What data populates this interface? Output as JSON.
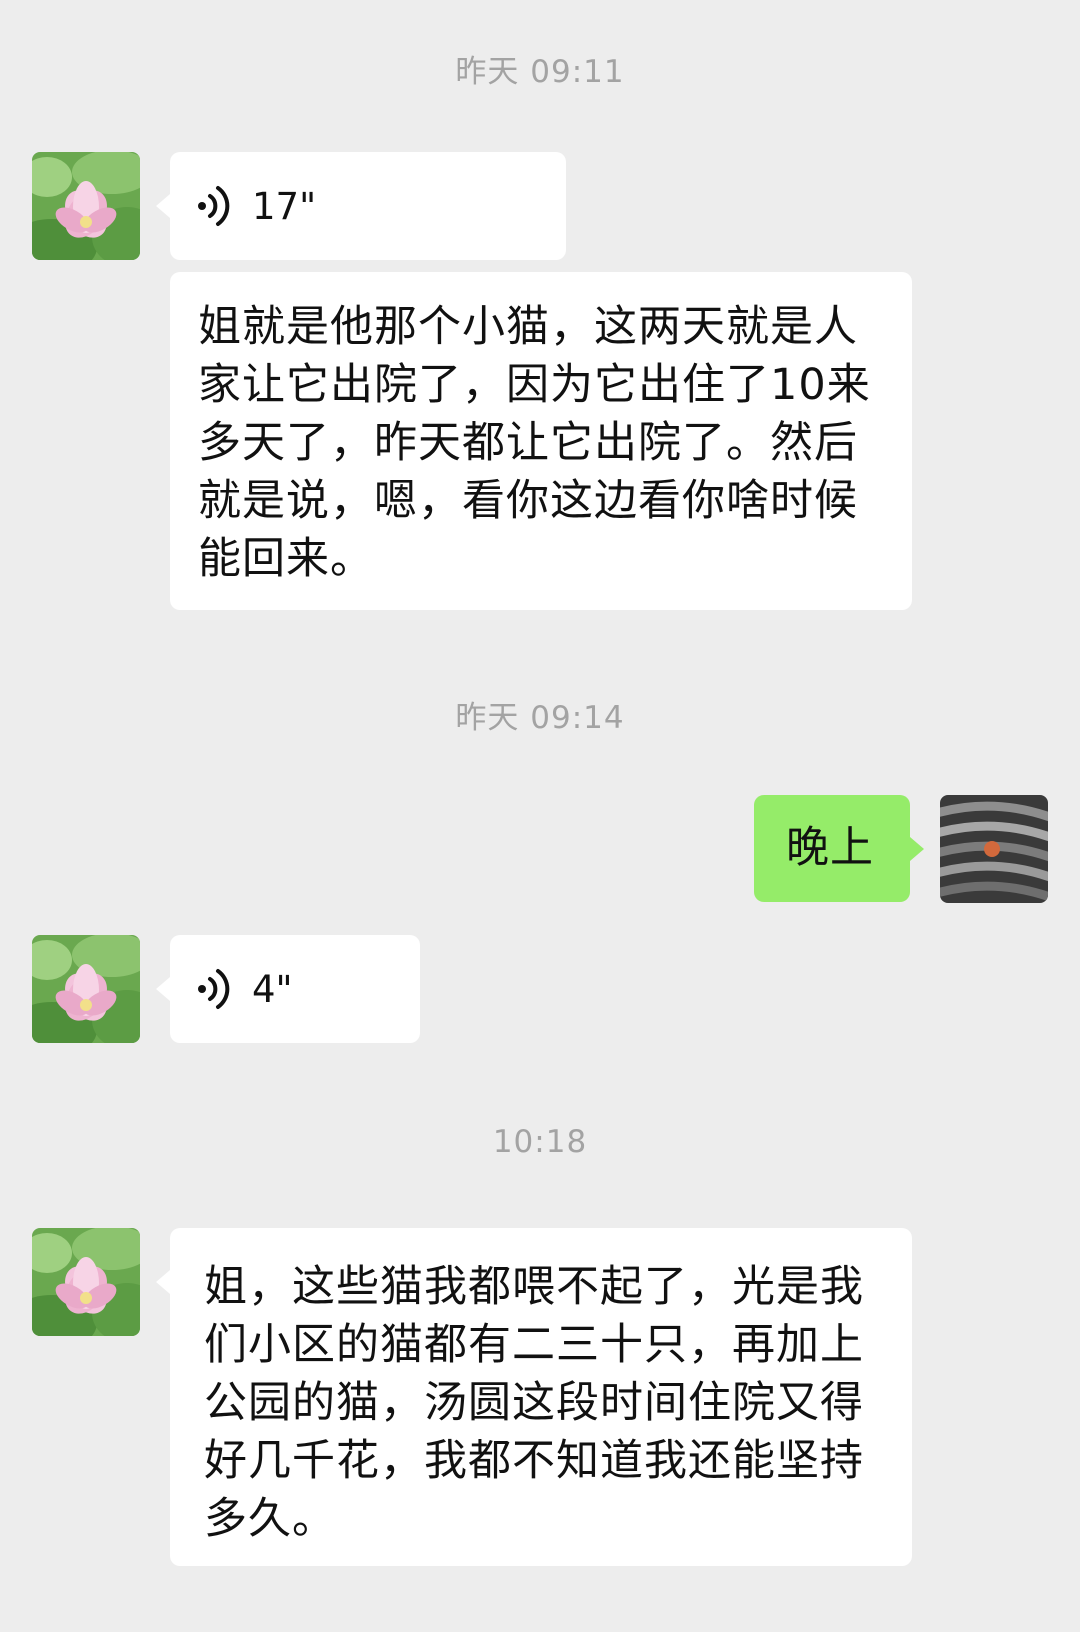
{
  "timestamps": [
    "昨天 09:11",
    "昨天 09:14",
    "10:18"
  ],
  "messages": {
    "m1": {
      "type": "voice",
      "duration": "17\""
    },
    "m2": {
      "type": "text",
      "text": "姐就是他那个小猫，这两天就是人\n家让它出院了，因为它出住了10来\n多天了，昨天都让它出院了。然后\n就是说，嗯，看你这边看你啥时候\n能回来。"
    },
    "m3": {
      "type": "text",
      "text": "晚上"
    },
    "m4": {
      "type": "voice",
      "duration": "4\""
    },
    "m5": {
      "type": "text",
      "text": "姐，这些猫我都喂不起了，光是我\n们小区的猫都有二三十只，再加上\n公园的猫，汤圆这段时间住院又得\n好几千花，我都不知道我还能坚持\n多久。"
    }
  },
  "icons": {
    "contact_avatar": "lotus-flower-avatar",
    "self_avatar": "steel-cable-avatar",
    "voice": "voice-wave-icon"
  },
  "colors": {
    "background": "#ededed",
    "incoming_bubble": "#ffffff",
    "outgoing_bubble": "#95ec69",
    "timestamp_text": "#a3a3a3"
  }
}
